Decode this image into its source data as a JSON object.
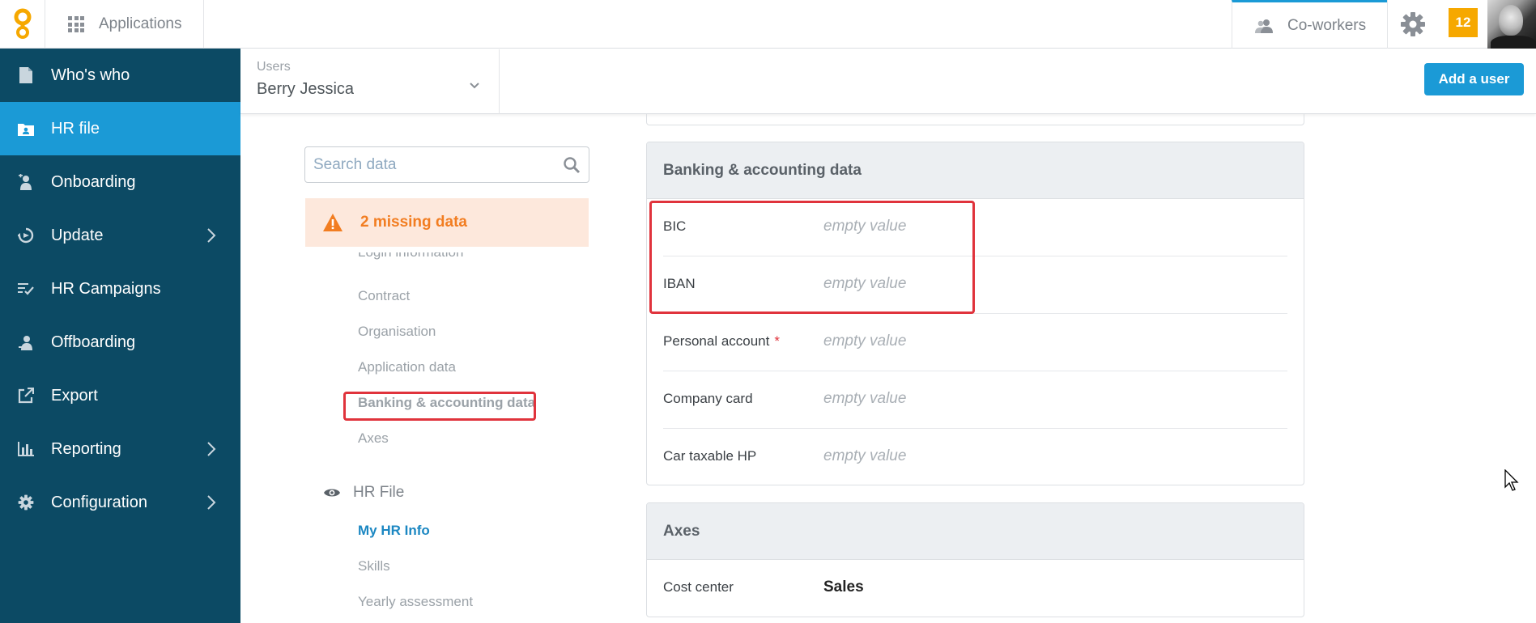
{
  "topbar": {
    "apps_label": "Applications",
    "coworkers_label": "Co-workers",
    "notifications_count": "12",
    "accent_color": "#1b9ad6",
    "notification_color": "#f6a800"
  },
  "sidebar": {
    "background": "#0c4a64",
    "items": [
      {
        "label": "Who's who",
        "icon": "document-icon"
      },
      {
        "label": "HR file",
        "icon": "folder-user-icon",
        "active": true
      },
      {
        "label": "Onboarding",
        "icon": "user-add-icon"
      },
      {
        "label": "Update",
        "icon": "sync-icon",
        "has_submenu": true
      },
      {
        "label": "HR Campaigns",
        "icon": "checklist-icon"
      },
      {
        "label": "Offboarding",
        "icon": "user-remove-icon"
      },
      {
        "label": "Export",
        "icon": "external-link-icon"
      },
      {
        "label": "Reporting",
        "icon": "bar-chart-icon",
        "has_submenu": true
      },
      {
        "label": "Configuration",
        "icon": "gear-icon",
        "has_submenu": true
      }
    ]
  },
  "subheader": {
    "users_label": "Users",
    "selected_user": "Berry Jessica",
    "add_user_label": "Add a user"
  },
  "left": {
    "search_placeholder": "Search data",
    "missing_label": "2 missing data",
    "sections_clipped": "Login information",
    "sections": [
      "Contract",
      "Organisation",
      "Application data",
      "Banking & accounting data",
      "Axes"
    ],
    "hr_file_heading": "HR File",
    "hr_file_items": [
      "My HR Info",
      "Skills",
      "Yearly assessment"
    ]
  },
  "cards": {
    "banking": {
      "title": "Banking & accounting data",
      "rows": [
        {
          "label": "BIC",
          "value": "empty value"
        },
        {
          "label": "IBAN",
          "value": "empty value"
        },
        {
          "label": "Personal account",
          "required_mark": "*",
          "value": "empty value"
        },
        {
          "label": "Company card",
          "value": "empty value"
        },
        {
          "label": "Car taxable HP",
          "value": "empty value"
        }
      ]
    },
    "axes": {
      "title": "Axes",
      "rows": [
        {
          "label": "Cost center",
          "value": "Sales"
        }
      ]
    }
  }
}
